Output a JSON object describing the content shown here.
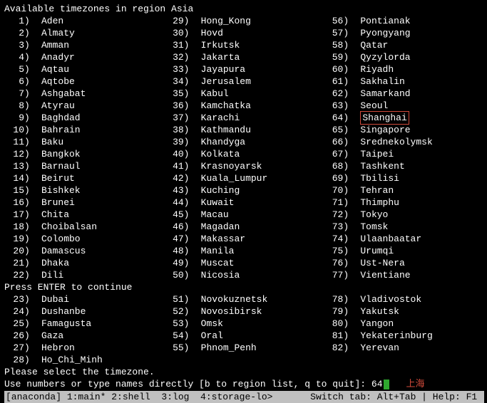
{
  "header": "Available timezones in region Asia",
  "columns": [
    [
      {
        "n": "1",
        "name": "Aden"
      },
      {
        "n": "2",
        "name": "Almaty"
      },
      {
        "n": "3",
        "name": "Amman"
      },
      {
        "n": "4",
        "name": "Anadyr"
      },
      {
        "n": "5",
        "name": "Aqtau"
      },
      {
        "n": "6",
        "name": "Aqtobe"
      },
      {
        "n": "7",
        "name": "Ashgabat"
      },
      {
        "n": "8",
        "name": "Atyrau"
      },
      {
        "n": "9",
        "name": "Baghdad"
      },
      {
        "n": "10",
        "name": "Bahrain"
      },
      {
        "n": "11",
        "name": "Baku"
      },
      {
        "n": "12",
        "name": "Bangkok"
      },
      {
        "n": "13",
        "name": "Barnaul"
      },
      {
        "n": "14",
        "name": "Beirut"
      },
      {
        "n": "15",
        "name": "Bishkek"
      },
      {
        "n": "16",
        "name": "Brunei"
      },
      {
        "n": "17",
        "name": "Chita"
      },
      {
        "n": "18",
        "name": "Choibalsan"
      },
      {
        "n": "19",
        "name": "Colombo"
      },
      {
        "n": "20",
        "name": "Damascus"
      },
      {
        "n": "21",
        "name": "Dhaka"
      },
      {
        "n": "22",
        "name": "Dili"
      }
    ],
    [
      {
        "n": "29",
        "name": "Hong_Kong"
      },
      {
        "n": "30",
        "name": "Hovd"
      },
      {
        "n": "31",
        "name": "Irkutsk"
      },
      {
        "n": "32",
        "name": "Jakarta"
      },
      {
        "n": "33",
        "name": "Jayapura"
      },
      {
        "n": "34",
        "name": "Jerusalem"
      },
      {
        "n": "35",
        "name": "Kabul"
      },
      {
        "n": "36",
        "name": "Kamchatka"
      },
      {
        "n": "37",
        "name": "Karachi"
      },
      {
        "n": "38",
        "name": "Kathmandu"
      },
      {
        "n": "39",
        "name": "Khandyga"
      },
      {
        "n": "40",
        "name": "Kolkata"
      },
      {
        "n": "41",
        "name": "Krasnoyarsk"
      },
      {
        "n": "42",
        "name": "Kuala_Lumpur"
      },
      {
        "n": "43",
        "name": "Kuching"
      },
      {
        "n": "44",
        "name": "Kuwait"
      },
      {
        "n": "45",
        "name": "Macau"
      },
      {
        "n": "46",
        "name": "Magadan"
      },
      {
        "n": "47",
        "name": "Makassar"
      },
      {
        "n": "48",
        "name": "Manila"
      },
      {
        "n": "49",
        "name": "Muscat"
      },
      {
        "n": "50",
        "name": "Nicosia"
      }
    ],
    [
      {
        "n": "56",
        "name": "Pontianak"
      },
      {
        "n": "57",
        "name": "Pyongyang"
      },
      {
        "n": "58",
        "name": "Qatar"
      },
      {
        "n": "59",
        "name": "Qyzylorda"
      },
      {
        "n": "60",
        "name": "Riyadh"
      },
      {
        "n": "61",
        "name": "Sakhalin"
      },
      {
        "n": "62",
        "name": "Samarkand"
      },
      {
        "n": "63",
        "name": "Seoul"
      },
      {
        "n": "64",
        "name": "Shanghai",
        "highlight": true
      },
      {
        "n": "65",
        "name": "Singapore"
      },
      {
        "n": "66",
        "name": "Srednekolymsk"
      },
      {
        "n": "67",
        "name": "Taipei"
      },
      {
        "n": "68",
        "name": "Tashkent"
      },
      {
        "n": "69",
        "name": "Tbilisi"
      },
      {
        "n": "70",
        "name": "Tehran"
      },
      {
        "n": "71",
        "name": "Thimphu"
      },
      {
        "n": "72",
        "name": "Tokyo"
      },
      {
        "n": "73",
        "name": "Tomsk"
      },
      {
        "n": "74",
        "name": "Ulaanbaatar"
      },
      {
        "n": "75",
        "name": "Urumqi"
      },
      {
        "n": "76",
        "name": "Ust-Nera"
      },
      {
        "n": "77",
        "name": "Vientiane"
      }
    ]
  ],
  "continue_msg": "Press ENTER to continue",
  "columns2": [
    [
      {
        "n": "23",
        "name": "Dubai"
      },
      {
        "n": "24",
        "name": "Dushanbe"
      },
      {
        "n": "25",
        "name": "Famagusta"
      },
      {
        "n": "26",
        "name": "Gaza"
      },
      {
        "n": "27",
        "name": "Hebron"
      },
      {
        "n": "28",
        "name": "Ho_Chi_Minh"
      }
    ],
    [
      {
        "n": "51",
        "name": "Novokuznetsk"
      },
      {
        "n": "52",
        "name": "Novosibirsk"
      },
      {
        "n": "53",
        "name": "Omsk"
      },
      {
        "n": "54",
        "name": "Oral"
      },
      {
        "n": "55",
        "name": "Phnom_Penh"
      }
    ],
    [
      {
        "n": "78",
        "name": "Vladivostok"
      },
      {
        "n": "79",
        "name": "Yakutsk"
      },
      {
        "n": "80",
        "name": "Yangon"
      },
      {
        "n": "81",
        "name": "Yekaterinburg"
      },
      {
        "n": "82",
        "name": "Yerevan"
      }
    ]
  ],
  "select_msg": "Please select the timezone.",
  "prompt_prefix": "Use numbers or type names directly [b to region list, q to quit]: ",
  "prompt_input": "64",
  "annotation": "上海",
  "statusbar": {
    "left": "[anaconda] 1:main* 2:shell  3:log  4:storage-lo>",
    "switch": " Switch tab: Alt+Tab ",
    "help": "| Help: F1 "
  }
}
